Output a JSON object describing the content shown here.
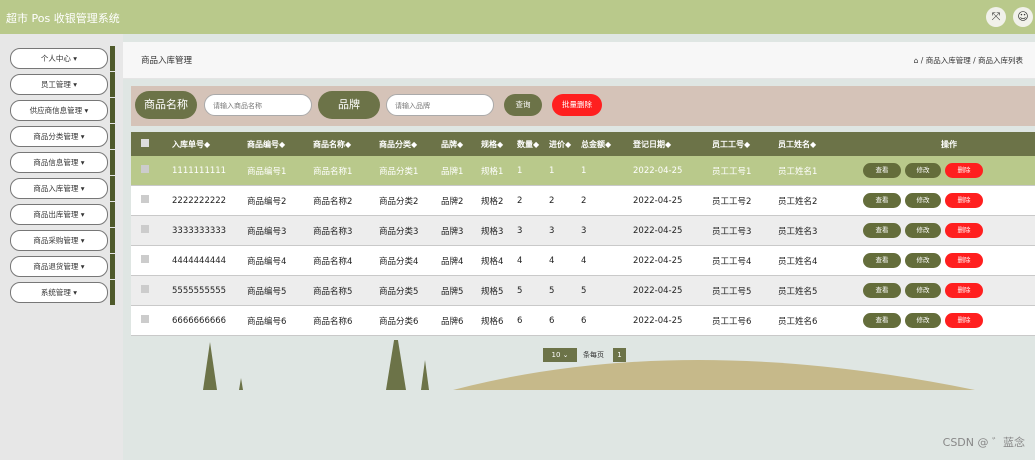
{
  "app": {
    "title": "超市 Pos 收银管理系统"
  },
  "top_icons": [
    "fullscreen-icon",
    "user-icon"
  ],
  "sidebar": {
    "items": [
      {
        "label": "个人中心 ▾"
      },
      {
        "label": "员工管理 ▾"
      },
      {
        "label": "供应商信息管理 ▾"
      },
      {
        "label": "商品分类管理 ▾"
      },
      {
        "label": "商品信息管理 ▾"
      },
      {
        "label": "商品入库管理 ▾"
      },
      {
        "label": "商品出库管理 ▾"
      },
      {
        "label": "商品采购管理 ▾"
      },
      {
        "label": "商品退货管理 ▾"
      },
      {
        "label": "系统管理 ▾"
      }
    ]
  },
  "page": {
    "title": "商品入库管理",
    "breadcrumb": "/ 商品入库管理 / 商品入库列表"
  },
  "search": {
    "name_label": "商品名称",
    "name_placeholder": "请输入商品名称",
    "brand_label": "品牌",
    "brand_placeholder": "请输入品牌",
    "query_label": "查询",
    "batch_delete_label": "批量删除"
  },
  "table": {
    "headers": [
      "入库单号◆",
      "商品编号◆",
      "商品名称◆",
      "商品分类◆",
      "品牌◆",
      "规格◆",
      "数量◆",
      "进价◆",
      "总金额◆",
      "登记日期◆",
      "员工工号◆",
      "员工姓名◆",
      "操作"
    ],
    "rows": [
      [
        "1111111111",
        "商品编号1",
        "商品名称1",
        "商品分类1",
        "品牌1",
        "规格1",
        "1",
        "1",
        "1",
        "2022-04-25",
        "员工工号1",
        "员工姓名1"
      ],
      [
        "2222222222",
        "商品编号2",
        "商品名称2",
        "商品分类2",
        "品牌2",
        "规格2",
        "2",
        "2",
        "2",
        "2022-04-25",
        "员工工号2",
        "员工姓名2"
      ],
      [
        "3333333333",
        "商品编号3",
        "商品名称3",
        "商品分类3",
        "品牌3",
        "规格3",
        "3",
        "3",
        "3",
        "2022-04-25",
        "员工工号3",
        "员工姓名3"
      ],
      [
        "4444444444",
        "商品编号4",
        "商品名称4",
        "商品分类4",
        "品牌4",
        "规格4",
        "4",
        "4",
        "4",
        "2022-04-25",
        "员工工号4",
        "员工姓名4"
      ],
      [
        "5555555555",
        "商品编号5",
        "商品名称5",
        "商品分类5",
        "品牌5",
        "规格5",
        "5",
        "5",
        "5",
        "2022-04-25",
        "员工工号5",
        "员工姓名5"
      ],
      [
        "6666666666",
        "商品编号6",
        "商品名称6",
        "商品分类6",
        "品牌6",
        "规格6",
        "6",
        "6",
        "6",
        "2022-04-25",
        "员工工号6",
        "员工姓名6"
      ]
    ],
    "actions": {
      "view": "查看",
      "edit": "修改",
      "delete": "删除"
    }
  },
  "pager": {
    "page_size": "10",
    "per_page_label": "条每页",
    "current_page": "1"
  },
  "watermark": "CSDN @ ゛蓝念"
}
